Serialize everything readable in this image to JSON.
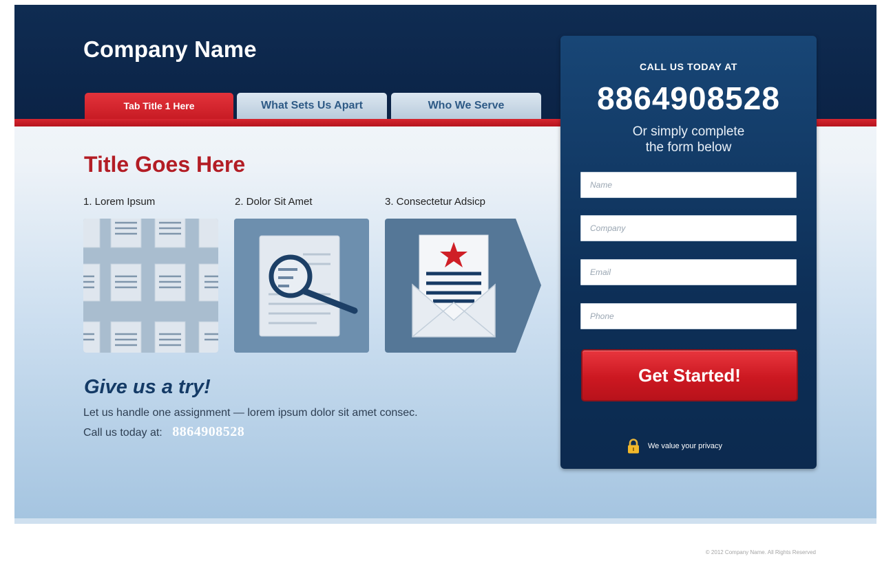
{
  "header": {
    "company_name": "Company Name"
  },
  "tabs": [
    {
      "label": "Tab Title 1 Here",
      "active": true
    },
    {
      "label": "What Sets Us Apart",
      "active": false
    },
    {
      "label": "Who We Serve",
      "active": false
    }
  ],
  "main": {
    "title": "Title Goes Here",
    "steps": [
      {
        "label": "1. Lorem Ipsum",
        "icon": "documents-grid-icon"
      },
      {
        "label": "2. Dolor Sit Amet",
        "icon": "document-magnifier-icon"
      },
      {
        "label": "3. Consectetur Adsicp",
        "icon": "envelope-letter-star-icon"
      }
    ],
    "try_title": "Give us a try!",
    "try_text": "Let us handle one assignment — lorem ipsum dolor sit amet consec.",
    "call_label": "Call us today at:",
    "call_number": "8864908528"
  },
  "form": {
    "call_today": "CALL US TODAY AT",
    "phone": "8864908528",
    "or_simply_line1": "Or simply complete",
    "or_simply_line2": "the form below",
    "fields": [
      {
        "placeholder": "Name",
        "value": ""
      },
      {
        "placeholder": "Company",
        "value": ""
      },
      {
        "placeholder": "Email",
        "value": ""
      },
      {
        "placeholder": "Phone",
        "value": ""
      }
    ],
    "submit_label": "Get Started!",
    "privacy_text": "We value your privacy"
  },
  "footer": {
    "copyright": "© 2012 Company Name. All Rights Reserved"
  },
  "colors": {
    "navy": "#0f2c52",
    "brand_red": "#c81b24",
    "tab_inactive": "#c8d7e6",
    "title_red": "#b31d25",
    "headline_blue": "#143a66"
  }
}
